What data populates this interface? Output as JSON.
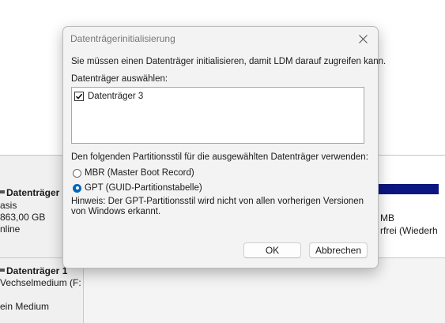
{
  "background": {
    "disks": [
      {
        "title": "Datenträger",
        "lines": [
          "asis",
          "863,00 GB",
          "nline"
        ]
      },
      {
        "title": "Datenträger 1",
        "lines": [
          "Vechselmedium (F:",
          "ein Medium"
        ]
      }
    ],
    "partition": {
      "size_fragment": "MB",
      "status_fragment": "rfrei (Wiederh",
      "bar_color": "#0b1680"
    }
  },
  "dialog": {
    "title": "Datenträgerinitialisierung",
    "intro": "Sie müssen einen Datenträger initialisieren, damit LDM darauf zugreifen kann.",
    "select_label": "Datenträger auswählen:",
    "disk_items": [
      {
        "label": "Datenträger 3",
        "checked": true
      }
    ],
    "partition_style_label": "Den folgenden Partitionsstil für die ausgewählten Datenträger verwenden:",
    "options": {
      "mbr": {
        "label": "MBR (Master Boot Record)",
        "selected": false
      },
      "gpt": {
        "label": "GPT (GUID-Partitionstabelle)",
        "selected": true
      }
    },
    "hint": "Hinweis: Der GPT-Partitionsstil wird nicht von allen vorherigen Versionen von Windows erkannt.",
    "ok_label": "OK",
    "cancel_label": "Abbrechen",
    "accent_color": "#0067c0"
  }
}
